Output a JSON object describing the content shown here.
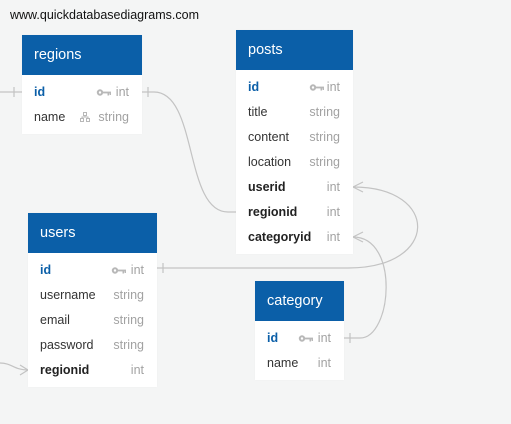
{
  "watermark": "www.quickdatabasediagrams.com",
  "tables": {
    "regions": {
      "title": "regions",
      "fields": [
        {
          "name": "id",
          "type": "int",
          "icon": "key-icon"
        },
        {
          "name": "name",
          "type": "string",
          "icon": "index-icon"
        }
      ]
    },
    "posts": {
      "title": "posts",
      "fields": [
        {
          "name": "id",
          "type": "int",
          "icon": "key-icon"
        },
        {
          "name": "title",
          "type": "string"
        },
        {
          "name": "content",
          "type": "string"
        },
        {
          "name": "location",
          "type": "string"
        },
        {
          "name": "userid",
          "type": "int"
        },
        {
          "name": "regionid",
          "type": "int"
        },
        {
          "name": "categoryid",
          "type": "int"
        }
      ]
    },
    "users": {
      "title": "users",
      "fields": [
        {
          "name": "id",
          "type": "int",
          "icon": "key-icon"
        },
        {
          "name": "username",
          "type": "string"
        },
        {
          "name": "email",
          "type": "string"
        },
        {
          "name": "password",
          "type": "string"
        },
        {
          "name": "regionid",
          "type": "int"
        }
      ]
    },
    "category": {
      "title": "category",
      "fields": [
        {
          "name": "id",
          "type": "int",
          "icon": "key-icon"
        },
        {
          "name": "name",
          "type": "int"
        }
      ]
    }
  },
  "colors": {
    "header": "#0b5fa8",
    "primary_key": "#0b5fa8",
    "type_text": "#a2a2a2",
    "link_line": "#c3c3c3",
    "background": "#f4f5f5"
  }
}
